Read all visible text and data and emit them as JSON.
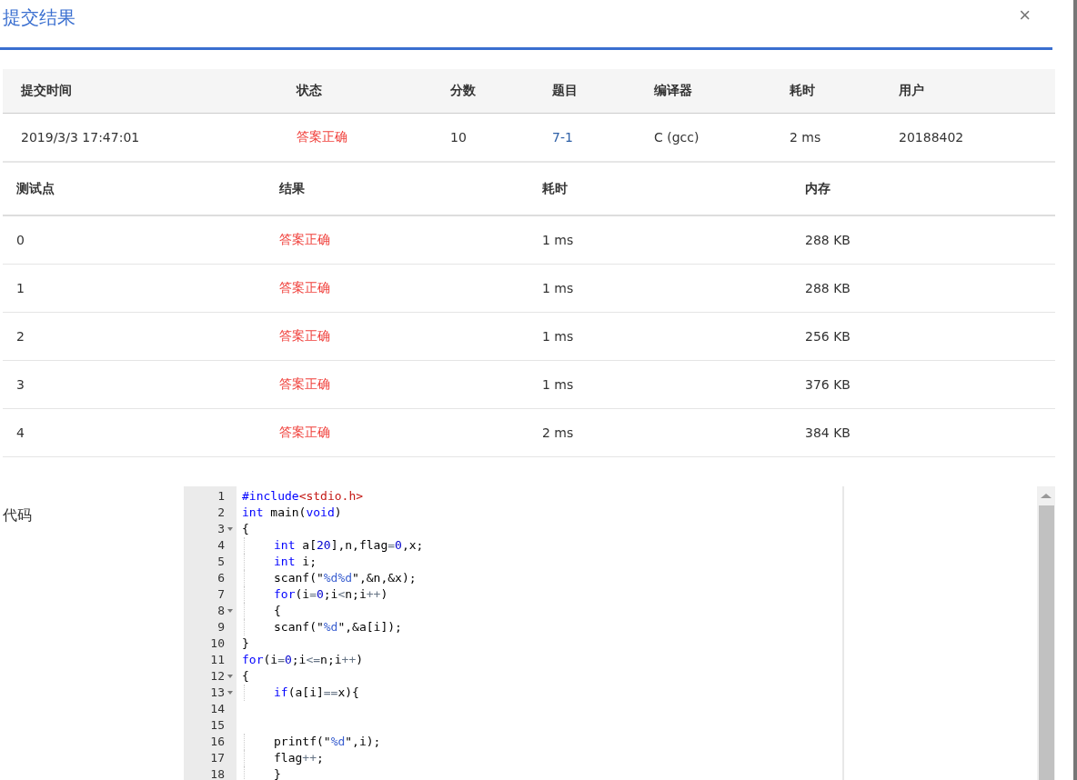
{
  "dialog": {
    "title": "提交结果",
    "close": "×"
  },
  "summary": {
    "columns": [
      "提交时间",
      "状态",
      "分数",
      "题目",
      "编译器",
      "耗时",
      "用户"
    ],
    "row": [
      {
        "kind": "text",
        "text": "2019/3/3 17:47:01"
      },
      {
        "kind": "status",
        "text": "答案正确"
      },
      {
        "kind": "text",
        "text": "10"
      },
      {
        "kind": "link",
        "text": "7-1"
      },
      {
        "kind": "text",
        "text": "C (gcc)"
      },
      {
        "kind": "text",
        "text": "2 ms"
      },
      {
        "kind": "text",
        "text": "20188402"
      }
    ]
  },
  "tests": {
    "columns": [
      "测试点",
      "结果",
      "耗时",
      "内存"
    ],
    "rows": [
      [
        "0",
        "答案正确",
        "1 ms",
        "288 KB"
      ],
      [
        "1",
        "答案正确",
        "1 ms",
        "288 KB"
      ],
      [
        "2",
        "答案正确",
        "1 ms",
        "256 KB"
      ],
      [
        "3",
        "答案正确",
        "1 ms",
        "376 KB"
      ],
      [
        "4",
        "答案正确",
        "2 ms",
        "384 KB"
      ]
    ]
  },
  "code": {
    "label": "代码",
    "lines": [
      {
        "number": "1",
        "fold": false,
        "indented": false,
        "tokens": [
          {
            "kind": "kw",
            "text": "#include"
          },
          {
            "kind": "inc",
            "text": "<stdio.h>"
          }
        ]
      },
      {
        "number": "2",
        "fold": false,
        "indented": false,
        "tokens": [
          {
            "kind": "kw",
            "text": "int"
          },
          {
            "kind": "plain",
            "text": " main("
          },
          {
            "kind": "kw",
            "text": "void"
          },
          {
            "kind": "plain",
            "text": ")"
          }
        ]
      },
      {
        "number": "3",
        "fold": true,
        "indented": false,
        "tokens": [
          {
            "kind": "plain",
            "text": "{"
          }
        ]
      },
      {
        "number": "4",
        "fold": false,
        "indented": true,
        "tokens": [
          {
            "kind": "kw",
            "text": "int"
          },
          {
            "kind": "plain",
            "text": " a["
          },
          {
            "kind": "num",
            "text": "20"
          },
          {
            "kind": "plain",
            "text": "],n,flag"
          },
          {
            "kind": "op",
            "text": "="
          },
          {
            "kind": "num",
            "text": "0"
          },
          {
            "kind": "plain",
            "text": ",x;"
          }
        ]
      },
      {
        "number": "5",
        "fold": false,
        "indented": true,
        "tokens": [
          {
            "kind": "kw",
            "text": "int"
          },
          {
            "kind": "plain",
            "text": " i;"
          }
        ]
      },
      {
        "number": "6",
        "fold": false,
        "indented": true,
        "tokens": [
          {
            "kind": "plain",
            "text": "scanf(\""
          },
          {
            "kind": "str",
            "text": "%d%d"
          },
          {
            "kind": "plain",
            "text": "\",&n,&x);"
          }
        ]
      },
      {
        "number": "7",
        "fold": false,
        "indented": true,
        "tokens": [
          {
            "kind": "kw",
            "text": "for"
          },
          {
            "kind": "plain",
            "text": "(i"
          },
          {
            "kind": "op",
            "text": "="
          },
          {
            "kind": "num",
            "text": "0"
          },
          {
            "kind": "plain",
            "text": ";i"
          },
          {
            "kind": "op",
            "text": "<"
          },
          {
            "kind": "plain",
            "text": "n;i"
          },
          {
            "kind": "op",
            "text": "++"
          },
          {
            "kind": "plain",
            "text": ")"
          }
        ]
      },
      {
        "number": "8",
        "fold": true,
        "indented": true,
        "tokens": [
          {
            "kind": "plain",
            "text": "{"
          }
        ]
      },
      {
        "number": "9",
        "fold": false,
        "indented": true,
        "tokens": [
          {
            "kind": "plain",
            "text": "scanf(\""
          },
          {
            "kind": "str",
            "text": "%d"
          },
          {
            "kind": "plain",
            "text": "\",&a[i]);"
          }
        ]
      },
      {
        "number": "10",
        "fold": false,
        "indented": false,
        "tokens": [
          {
            "kind": "plain",
            "text": "}"
          }
        ]
      },
      {
        "number": "11",
        "fold": false,
        "indented": false,
        "tokens": [
          {
            "kind": "kw",
            "text": "for"
          },
          {
            "kind": "plain",
            "text": "(i"
          },
          {
            "kind": "op",
            "text": "="
          },
          {
            "kind": "num",
            "text": "0"
          },
          {
            "kind": "plain",
            "text": ";i"
          },
          {
            "kind": "op",
            "text": "<="
          },
          {
            "kind": "plain",
            "text": "n;i"
          },
          {
            "kind": "op",
            "text": "++"
          },
          {
            "kind": "plain",
            "text": ")"
          }
        ]
      },
      {
        "number": "12",
        "fold": true,
        "indented": false,
        "tokens": [
          {
            "kind": "plain",
            "text": "{"
          }
        ]
      },
      {
        "number": "13",
        "fold": true,
        "indented": true,
        "tokens": [
          {
            "kind": "kw",
            "text": "if"
          },
          {
            "kind": "plain",
            "text": "(a[i]"
          },
          {
            "kind": "op",
            "text": "=="
          },
          {
            "kind": "plain",
            "text": "x){"
          }
        ]
      },
      {
        "number": "14",
        "fold": false,
        "indented": false
      },
      {
        "number": "15",
        "fold": false,
        "indented": false
      },
      {
        "number": "16",
        "fold": false,
        "indented": true,
        "tokens": [
          {
            "kind": "plain",
            "text": "printf(\""
          },
          {
            "kind": "str",
            "text": "%d"
          },
          {
            "kind": "plain",
            "text": "\",i);"
          }
        ]
      },
      {
        "number": "17",
        "fold": false,
        "indented": true,
        "tokens": [
          {
            "kind": "plain",
            "text": "flag"
          },
          {
            "kind": "op",
            "text": "++"
          },
          {
            "kind": "plain",
            "text": ";"
          }
        ]
      },
      {
        "number": "18",
        "fold": false,
        "indented": true,
        "tokens": [
          {
            "kind": "plain",
            "text": "}"
          }
        ]
      }
    ]
  }
}
